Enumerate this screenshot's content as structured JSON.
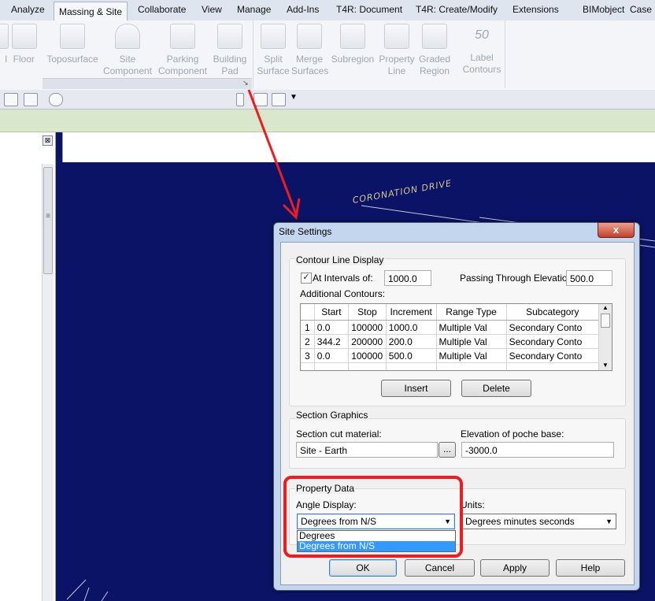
{
  "ribbon_tabs": [
    "Analyze",
    "Massing & Site",
    "Collaborate",
    "View",
    "Manage",
    "Add-Ins",
    "T4R: Document",
    "T4R: Create/Modify",
    "Extensions",
    "BIMobject",
    "Case D"
  ],
  "ribbon_buttons": {
    "wall_fragment": "l",
    "floor": "Floor",
    "toposurface": "Toposurface",
    "site_component": [
      "Site",
      "Component"
    ],
    "parking_component": [
      "Parking",
      "Component"
    ],
    "building_pad": [
      "Building",
      "Pad"
    ],
    "split_surface": [
      "Split",
      "Surface"
    ],
    "merge_surfaces": [
      "Merge",
      "Surfaces"
    ],
    "subregion": "Subregion",
    "property_line": [
      "Property",
      "Line"
    ],
    "graded_region": [
      "Graded",
      "Region"
    ],
    "label_contours": [
      "Label",
      "Contours"
    ],
    "label_contours_glyph": "50"
  },
  "left_panel": {
    "close_glyph": "⊠",
    "scroll_grip": "≡"
  },
  "canvas": {
    "street_label": "CORONATION DRIVE"
  },
  "dialog": {
    "title": "Site Settings",
    "close_glyph": "x",
    "contour": {
      "group_label": "Contour Line Display",
      "at_intervals_checked": true,
      "at_intervals_label": "At Intervals of:",
      "interval_value": "1000.0",
      "passing_label": "Passing Through Elevation:",
      "passing_value": "500.0",
      "additional_label": "Additional Contours:",
      "columns": [
        "",
        "Start",
        "Stop",
        "Increment",
        "Range Type",
        "Subcategory"
      ],
      "rows": [
        [
          "1",
          "0.0",
          "100000",
          "1000.0",
          "Multiple Val",
          "Secondary Conto"
        ],
        [
          "2",
          "344.2",
          "200000",
          "200.0",
          "Multiple Val",
          "Secondary Conto"
        ],
        [
          "3",
          "0.0",
          "100000",
          "500.0",
          "Multiple Val",
          "Secondary Conto"
        ]
      ],
      "insert_label": "Insert",
      "delete_label": "Delete"
    },
    "section": {
      "group_label": "Section Graphics",
      "cut_material_label": "Section cut material:",
      "cut_material_value": "Site - Earth",
      "browse_label": "...",
      "poche_label": "Elevation of poche base:",
      "poche_value": "-3000.0"
    },
    "property": {
      "group_label": "Property Data",
      "angle_label": "Angle Display:",
      "angle_value": "Degrees from N/S",
      "angle_options": [
        "Degrees",
        "Degrees from N/S"
      ],
      "units_label": "Units:",
      "units_value": "Degrees minutes seconds"
    },
    "buttons": {
      "ok": "OK",
      "cancel": "Cancel",
      "apply": "Apply",
      "help": "Help"
    }
  },
  "colors": {
    "canvas": "#0b1366",
    "highlight": "#ee1c1c",
    "selection": "#3399ff"
  }
}
